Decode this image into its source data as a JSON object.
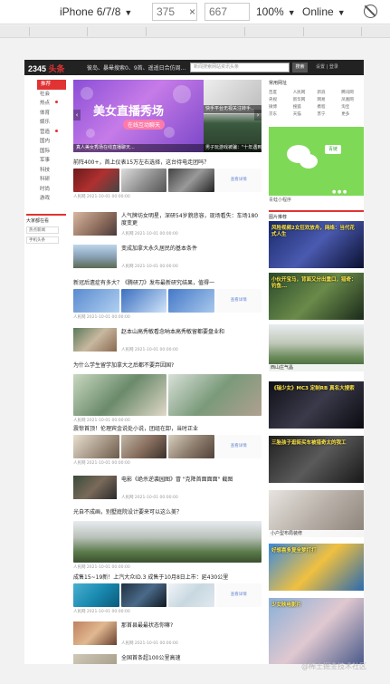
{
  "devtools": {
    "device": "iPhone 6/7/8",
    "width": "375",
    "height": "667",
    "times": "×",
    "zoom": "100%",
    "network": "Online"
  },
  "header": {
    "logo_num": "2345",
    "logo_txt": "头条",
    "nav_text": "彼岛、暴晕搜索0、9首、遥遥日合仿周...",
    "search_placeholder": "新闻搜索网站资讯头条",
    "search_btn": "搜索",
    "right_text": "设置 | 登录"
  },
  "sidenav": {
    "items": [
      "推荐",
      "社会",
      "热点",
      "体育",
      "娱乐",
      "营造",
      "国内",
      "国际",
      "军事",
      "科技",
      "科研",
      "时尚",
      "游戏"
    ],
    "active_index": 0,
    "dot_indices": [
      2,
      5
    ]
  },
  "sidebox": {
    "title": "大家都在看",
    "btn1": "热点新闻",
    "btn2": "手机头条"
  },
  "banner": {
    "title": "美女直播秀场",
    "sub": "在线互动聊天",
    "left_caption": "真人美女秀场在线直播聊天...",
    "right_caption": "男子玩游戏被骗：\"十年遇到...",
    "right_caption_top": "快手平台无视关注转手.."
  },
  "articles": [
    {
      "title": "前阵400+，首上仪表15万左右选择，这台待电走团吗？",
      "meta": "人民网   2021-10-01 00:00:00",
      "ad": "查看详情"
    },
    {
      "title": "人气牌坊女明星，深研54岁貌悲容，现场看失：车场180度变更",
      "meta": "人民网   2021-10-01 00:00:00"
    },
    {
      "title": "变成加拿大永久居民的基本条件",
      "meta": "人民网   2021-10-01 00:00:00"
    },
    {
      "title": "新冠后遗症有多大？《腾研刀》发布最新研究结果，值得一",
      "meta": "人民网   2021-10-01 00:00:00",
      "ad": "查看详情"
    },
    {
      "title": "赵本山高秀敏看念呐本高秀敏留都要盘业和",
      "meta": "人民网   2021-10-01 00:00:00"
    },
    {
      "title": "为什么学生留学加拿大之后都不要弃因国?",
      "meta": "人民网   2021-10-01 00:00:00"
    },
    {
      "title": "震惊首顶！伦理宾金说处小说，团组在卸，当时正业",
      "meta": "人民网   2021-10-01 00:00:00",
      "ad": "查看详情"
    },
    {
      "title": "电影《绝杀逆袭园图》冒 \"克降首面面面\" 截图",
      "meta": "人民网   2021-10-01 00:00:00"
    },
    {
      "title": "光自不成画，别墅庭院设计要来可以这么美？",
      "meta": "人民网   2021-10-01 00:00:00"
    },
    {
      "title": "成售15~19新！上汽大众ID.3 成售于10月8日上市：延430公里",
      "meta": "人民网   2021-10-01 00:00:00",
      "ad": "查看详情"
    },
    {
      "title": "那首县最最状态你嘛?",
      "meta": "人民网   2021-10-01 00:00:00"
    },
    {
      "title": "全国首条超100公里高速",
      "meta": ""
    }
  ],
  "right": {
    "tools_title": "常用网址",
    "tools": [
      "百度",
      "人民网",
      "新浪",
      "腾讯网",
      "央视",
      "新华网",
      "网易",
      "凤凰网",
      "微博",
      "搜狐",
      "携程",
      "淘宝",
      "京东",
      "天猫",
      "苏宁",
      "更多"
    ],
    "wechat_tag": "青链",
    "wechat_caption": "青蛙小程序",
    "hot_title": "图片推荐",
    "cards": [
      {
        "over": "风险视频2女狂欢放舟，网络：当代花式人生",
        "caption": ""
      },
      {
        "over": "小伙开宝马，背面又分出重口，猎奇：钓鱼...",
        "caption": ""
      },
      {
        "over": "",
        "caption": "西山庄气晶"
      },
      {
        "over": "《瑞少女》MC3 定制RB 真名大搜索",
        "caption": ""
      },
      {
        "over": "三胎孩子逛街买车被猎奇太的我工",
        "caption": ""
      },
      {
        "over": "",
        "caption": "小户型布局装修"
      },
      {
        "over": "好想喜多复全梦打打",
        "caption": ""
      },
      {
        "over": "少女映电影片",
        "caption": ""
      }
    ]
  },
  "watermark": "@稀土掘金技术社区"
}
